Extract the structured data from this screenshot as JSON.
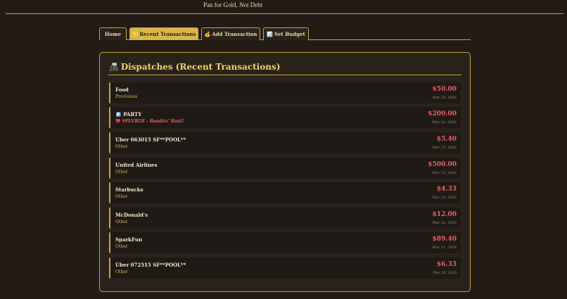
{
  "header": {
    "tagline": "Pan for Gold, Not Debt"
  },
  "tabs": [
    {
      "label": "Home",
      "icon": "",
      "active": false
    },
    {
      "label": "Recent Transactions",
      "icon": "🪙",
      "active": true
    },
    {
      "label": "Add Transaction",
      "icon": "💰",
      "active": false
    },
    {
      "label": "Set Budget",
      "icon": "📊",
      "active": false
    }
  ],
  "panel": {
    "title": "Dispatches (Recent Transactions)",
    "icon": "📠"
  },
  "transactions": [
    {
      "name": "Food",
      "category": "Provisions",
      "amount": "$50.00",
      "date": "Mar 23, 2026",
      "splurge": false,
      "icon": ""
    },
    {
      "name": "PARTY",
      "category": "SPLURGE - Bandits' Haul!",
      "amount": "$200.00",
      "date": "Mar 22, 2026",
      "splurge": true,
      "icon": "🪩",
      "category_icon": "💔"
    },
    {
      "name": "Uber 063015 SF**POOL**",
      "category": "Other",
      "amount": "$5.40",
      "date": "Mar 15, 2026",
      "splurge": false,
      "icon": ""
    },
    {
      "name": "United Airlines",
      "category": "Other",
      "amount": "$500.00",
      "date": "Mar 13, 2026",
      "splurge": false,
      "icon": ""
    },
    {
      "name": "Starbucks",
      "category": "Other",
      "amount": "$4.33",
      "date": "Mar 12, 2026",
      "splurge": false,
      "icon": ""
    },
    {
      "name": "McDonald's",
      "category": "Other",
      "amount": "$12.00",
      "date": "Mar 12, 2026",
      "splurge": false,
      "icon": ""
    },
    {
      "name": "SparkFun",
      "category": "Other",
      "amount": "$89.40",
      "date": "Mar 11, 2026",
      "splurge": false,
      "icon": ""
    },
    {
      "name": "Uber 072515 SF**POOL**",
      "category": "Other",
      "amount": "$6.33",
      "date": "Feb 26, 2026",
      "splurge": false,
      "icon": ""
    }
  ],
  "colors": {
    "accent": "#c9a33a",
    "gold_title": "#f0d35f",
    "expense": "#e8615f",
    "background": "#231c15"
  }
}
